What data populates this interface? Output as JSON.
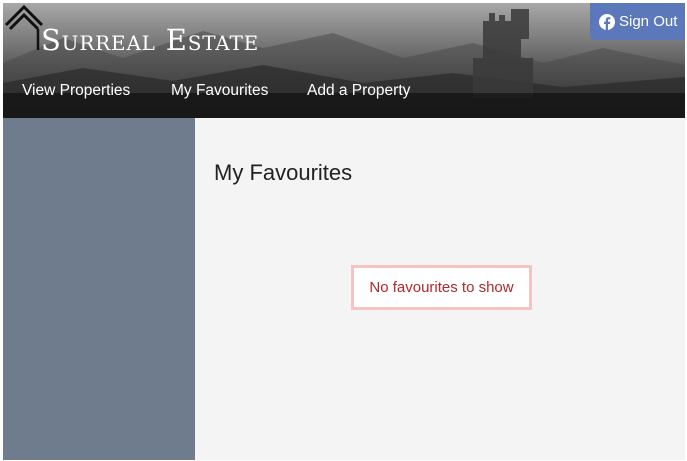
{
  "header": {
    "brand": "Surreal Estate",
    "nav": [
      {
        "label": "View Properties"
      },
      {
        "label": "My Favourites"
      },
      {
        "label": "Add a Property"
      }
    ],
    "sign_out_label": "Sign Out",
    "sign_out_icon": "facebook-icon"
  },
  "main": {
    "title": "My Favourites",
    "empty_message": "No favourites to show"
  },
  "colors": {
    "sidebar": "#6e7c8d",
    "sign_out_button": "#5b79ba",
    "empty_border": "#f6c3c3",
    "empty_text": "#b12a2a"
  }
}
